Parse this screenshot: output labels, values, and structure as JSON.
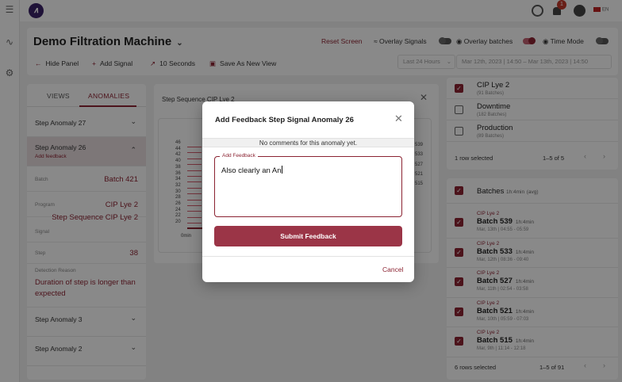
{
  "app": {
    "logo_glyph": "∧",
    "language": "EN",
    "notifications_count": "1"
  },
  "header": {
    "machine_name": "Demo Filtration Machine",
    "reset_label": "Reset Screen",
    "overlay_signals_label": "Overlay Signals",
    "overlay_batches_label": "Overlay batches",
    "time_mode_label": "Time Mode",
    "hide_panel_label": "Hide Panel",
    "add_signal_label": "Add Signal",
    "interval_label": "10 Seconds",
    "save_view_label": "Save As New View",
    "range_preset": "Last 24 Hours",
    "date_range": "Mar 12th, 2023 | 14:50  –  Mar 13th, 2023 | 14:50"
  },
  "left_panel": {
    "tabs": [
      {
        "label": "VIEWS"
      },
      {
        "label": "ANOMALIES"
      }
    ],
    "anomalies": [
      {
        "title": "Step Anomaly 27"
      },
      {
        "title": "Step Anomaly 26",
        "add_feedback": "Add feedback"
      },
      {
        "title": "Step Anomaly 3"
      },
      {
        "title": "Step Anomaly 2"
      }
    ],
    "details": {
      "batch_key": "Batch",
      "batch_val": "Batch 421",
      "program_key": "Program",
      "program_val": "CIP Lye 2",
      "signal_key": "Signal",
      "signal_val": "Step Sequence CIP Lye 2",
      "step_key": "Step",
      "step_val": "38",
      "reason_key": "Detection Reason",
      "reason_val": "Duration of step is longer than expected"
    }
  },
  "chart_panel": {
    "title": "Step Sequence CIP Lye 2",
    "y_ticks": [
      "46",
      "44",
      "42",
      "40",
      "38",
      "36",
      "34",
      "32",
      "30",
      "28",
      "26",
      "24",
      "22",
      "20"
    ],
    "x_tick": "0min",
    "right_labels": [
      "539",
      "533",
      "527",
      "521",
      "515"
    ]
  },
  "right_panel": {
    "programs": [
      {
        "name": "CIP Lye 2",
        "sub": "(91 Batches)",
        "checked": true
      },
      {
        "name": "Downtime",
        "sub": "(182 Batches)",
        "checked": false
      },
      {
        "name": "Production",
        "sub": "(89 Batches)",
        "checked": false
      }
    ],
    "programs_footer": {
      "selected": "1 row selected",
      "range": "1–5 of 5"
    },
    "batches_header": {
      "label": "Batches",
      "avg": "1h:4min",
      "avg_suffix": "(avg)"
    },
    "batches": [
      {
        "program": "CIP Lye 2",
        "name": "Batch 539",
        "dur": "1h:4min",
        "time": "Mar, 13th | 04:55 - 05:59"
      },
      {
        "program": "CIP Lye 2",
        "name": "Batch 533",
        "dur": "1h:4min",
        "time": "Mar, 12th | 08:36 - 09:40"
      },
      {
        "program": "CIP Lye 2",
        "name": "Batch 527",
        "dur": "1h:4min",
        "time": "Mar, 11th | 02:54 - 03:58"
      },
      {
        "program": "CIP Lye 2",
        "name": "Batch 521",
        "dur": "1h:4min",
        "time": "Mar, 10th | 05:59 - 07:03"
      },
      {
        "program": "CIP Lye 2",
        "name": "Batch 515",
        "dur": "1h:4min",
        "time": "Mar, 9th | 11:14 - 12:18"
      }
    ],
    "batches_footer": {
      "selected": "6 rows selected",
      "range": "1–5 of 91"
    }
  },
  "modal": {
    "title": "Add Feedback Step Signal Anomaly 26",
    "note": "No comments for this anomaly yet.",
    "field_label": "Add Feedback",
    "field_value": "Also clearly an An",
    "submit_label": "Submit Feedback",
    "cancel_label": "Cancel"
  },
  "colors": {
    "accent": "#8b2332",
    "submit": "#9b3547",
    "overlay": "rgba(0,0,0,0.45)"
  }
}
